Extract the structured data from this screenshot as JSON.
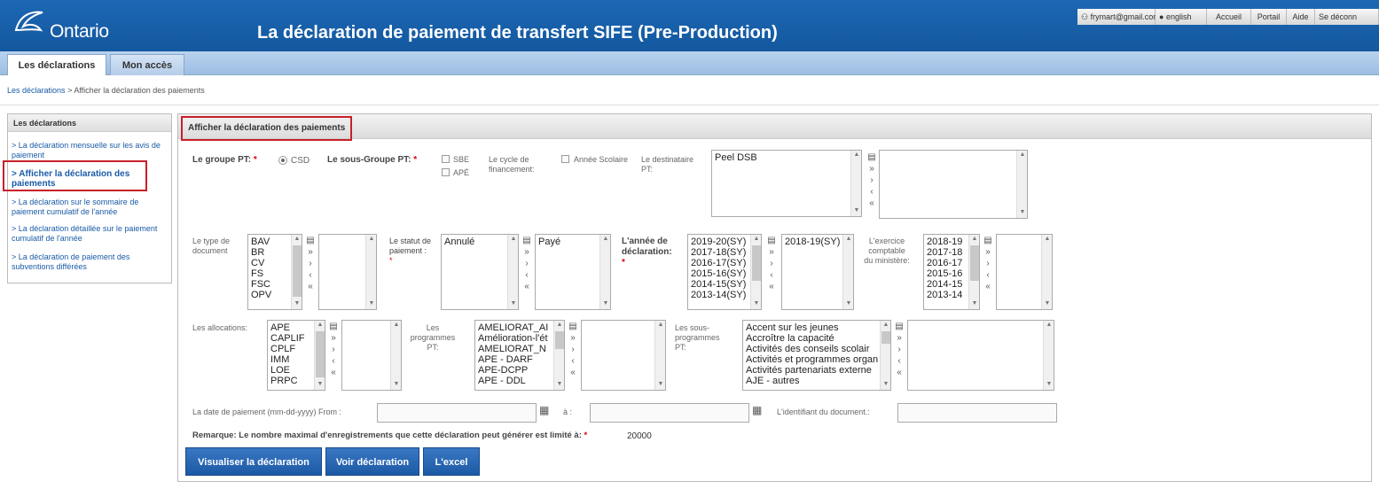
{
  "header": {
    "logo": "Ontario",
    "title": "La déclaration de paiement de transfert SIFE (Pre-Production)",
    "user": "frymart@gmail.com",
    "language": "english",
    "links": [
      "Accueil",
      "Portail",
      "Aide",
      "Se déconn"
    ]
  },
  "tabs": [
    "Les déclarations",
    "Mon accès"
  ],
  "breadcrumb": {
    "root": "Les déclarations",
    "sep": ">",
    "current": "Afficher la déclaration des paiements"
  },
  "sidebar": {
    "title": "Les déclarations",
    "items": [
      "> La déclaration mensuelle sur les avis de paiement",
      "> Afficher la déclaration des paiements",
      "> La déclaration sur le sommaire de paiement cumulatif de l'année",
      "> La déclaration détaillée sur le paiement cumulatif de l'année",
      "> La déclaration de paiement des subventions différées"
    ]
  },
  "panel": {
    "title": "Afficher la déclaration des paiements",
    "groupe_label": "Le groupe PT:",
    "groupe_option": "CSD",
    "sousgroupe_label": "Le sous-Groupe PT:",
    "sousgroupe_options": [
      "SBE",
      "APÉ"
    ],
    "cycle_label": "Le cycle de financement:",
    "cycle_option": "Année Scolaire",
    "destinataire_label": "Le destinataire PT:",
    "destinataire_items": [
      "Peel DSB"
    ],
    "type_label": "Le type de document",
    "type_items": [
      "BAV",
      "BR",
      "CV",
      "FS",
      "FSC",
      "OPV"
    ],
    "statut_label": "Le statut de paiement :",
    "statut_items": [
      "Annulé"
    ],
    "statut_selected": [
      "Payé"
    ],
    "annee_label": "L'année de déclaration:",
    "annee_items": [
      "2019-20(SY)",
      "2017-18(SY)",
      "2016-17(SY)",
      "2015-16(SY)",
      "2014-15(SY)",
      "2013-14(SY)"
    ],
    "annee_selected": [
      "2018-19(SY)"
    ],
    "exercice_label": "L'exercice comptable du ministère:",
    "exercice_items": [
      "2018-19",
      "2017-18",
      "2016-17",
      "2015-16",
      "2014-15",
      "2013-14"
    ],
    "alloc_label": "Les allocations:",
    "alloc_items": [
      "APE",
      "CAPLIF",
      "CPLF",
      "IMM",
      "LOE",
      "PRPC"
    ],
    "prog_label": "Les programmes PT:",
    "prog_items": [
      "AMELIORAT_AI",
      "Amélioration-l'ét",
      "AMELIORAT_N",
      "APE - DARF",
      "APE-DCPP",
      "APE - DDL"
    ],
    "sousprog_label": "Les sous-programmes PT:",
    "sousprog_items": [
      "Accent sur les jeunes",
      "Accroître la capacité",
      "Activités des conseils scolair",
      "Activités et programmes organ",
      "Activités partenariats externe",
      "AJE - autres"
    ],
    "date_label": "La date de paiement (mm-dd-yyyy) From :",
    "date_to": "à :",
    "ident_label": "L'identifiant du document.:",
    "remark_label": "Remarque: Le nombre maximal d'enregistrements que cette déclaration peut générer est limité à:",
    "remark_value": "20000",
    "buttons": [
      "Visualiser la déclaration",
      "Voir déclaration",
      "L'excel"
    ]
  }
}
